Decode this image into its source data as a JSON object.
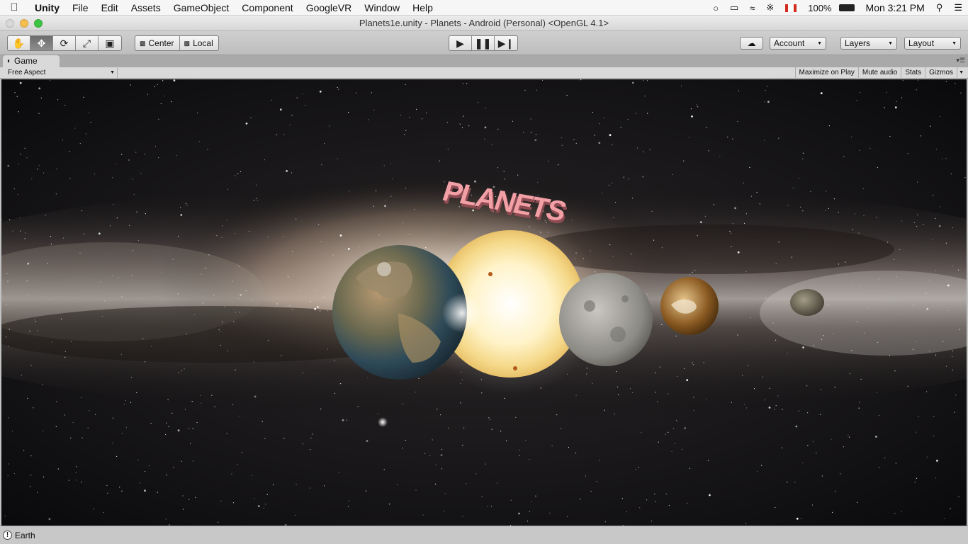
{
  "menubar": {
    "app": "Unity",
    "items": [
      "File",
      "Edit",
      "Assets",
      "GameObject",
      "Component",
      "GoogleVR",
      "Window",
      "Help"
    ],
    "battery": "100%",
    "clock": "Mon 3:21 PM"
  },
  "window": {
    "title": "Planets1e.unity - Planets - Android (Personal) <OpenGL 4.1>"
  },
  "toolbar": {
    "pivot_label": "Center",
    "space_label": "Local",
    "account_label": "Account",
    "layers_label": "Layers",
    "layout_label": "Layout"
  },
  "game_panel": {
    "tab_label": "Game",
    "aspect_label": "Free Aspect",
    "maximize_label": "Maximize on Play",
    "mute_label": "Mute audio",
    "stats_label": "Stats",
    "gizmos_label": "Gizmos"
  },
  "scene": {
    "title_3d_text": "PLANETS",
    "title_color": "#f2a0a6"
  },
  "status": {
    "message": "Earth"
  }
}
